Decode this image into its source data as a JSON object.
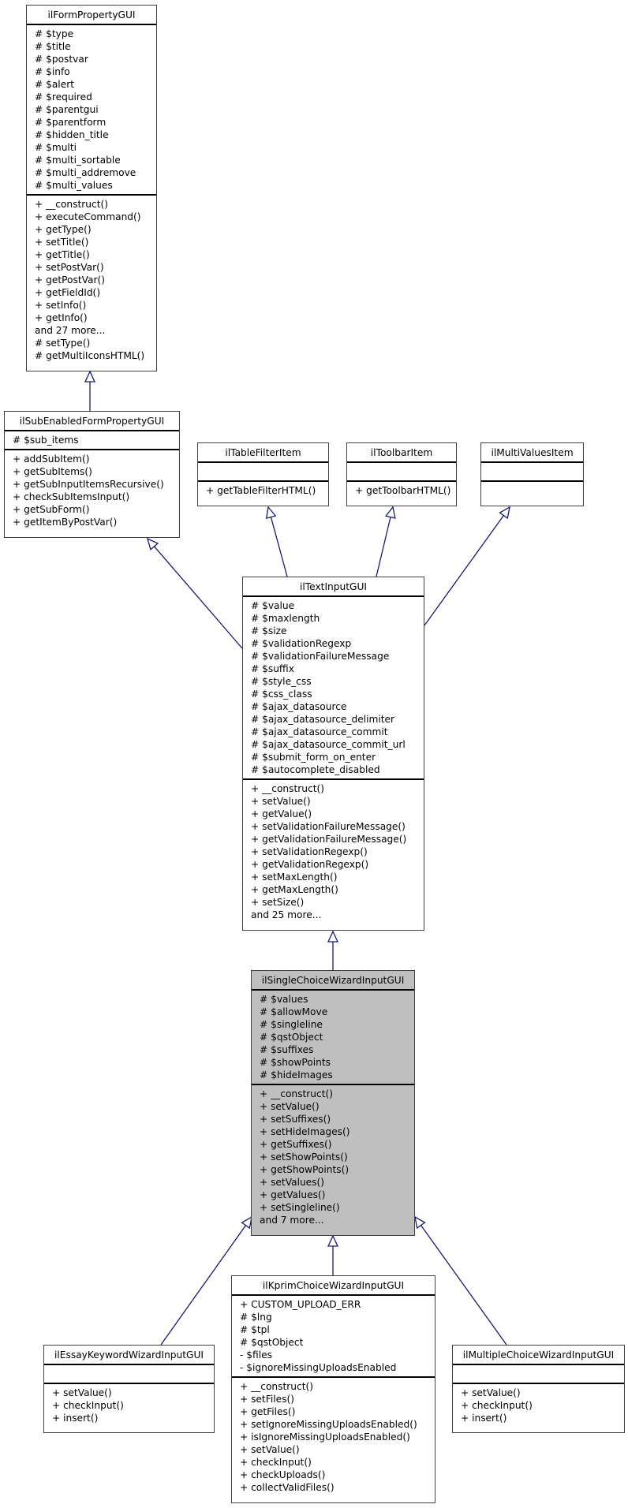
{
  "diagram": {
    "type": "uml-class-inheritance",
    "edge_color": "#191970",
    "highlight_color": "#bfbfbf"
  },
  "classes": {
    "formProperty": {
      "name": "ilFormPropertyGUI",
      "attributes": [
        "# $type",
        "# $title",
        "# $postvar",
        "# $info",
        "# $alert",
        "# $required",
        "# $parentgui",
        "# $parentform",
        "# $hidden_title",
        "# $multi",
        "# $multi_sortable",
        "# $multi_addremove",
        "# $multi_values"
      ],
      "methods": [
        "+ __construct()",
        "+ executeCommand()",
        "+ getType()",
        "+ setTitle()",
        "+ getTitle()",
        "+ setPostVar()",
        "+ getPostVar()",
        "+ getFieldId()",
        "+ setInfo()",
        "+ getInfo()",
        "and 27 more...",
        "# setType()",
        "# getMultiIconsHTML()"
      ]
    },
    "subEnabled": {
      "name": "ilSubEnabledFormPropertyGUI",
      "attributes": [
        "# $sub_items"
      ],
      "methods": [
        "+ addSubItem()",
        "+ getSubItems()",
        "+ getSubInputItemsRecursive()",
        "+ checkSubItemsInput()",
        "+ getSubForm()",
        "+ getItemByPostVar()"
      ]
    },
    "tableFilter": {
      "name": "ilTableFilterItem",
      "attributes": [],
      "methods": [
        "+ getTableFilterHTML()"
      ]
    },
    "toolbar": {
      "name": "ilToolbarItem",
      "attributes": [],
      "methods": [
        "+ getToolbarHTML()"
      ]
    },
    "multiValues": {
      "name": "ilMultiValuesItem",
      "attributes": [],
      "methods": []
    },
    "textInput": {
      "name": "ilTextInputGUI",
      "attributes": [
        "# $value",
        "# $maxlength",
        "# $size",
        "# $validationRegexp",
        "# $validationFailureMessage",
        "# $suffix",
        "# $style_css",
        "# $css_class",
        "# $ajax_datasource",
        "# $ajax_datasource_delimiter",
        "# $ajax_datasource_commit",
        "# $ajax_datasource_commit_url",
        "# $submit_form_on_enter",
        "# $autocomplete_disabled"
      ],
      "methods": [
        "+ __construct()",
        "+ setValue()",
        "+ getValue()",
        "+ setValidationFailureMessage()",
        "+ getValidationFailureMessage()",
        "+ setValidationRegexp()",
        "+ getValidationRegexp()",
        "+ setMaxLength()",
        "+ getMaxLength()",
        "+ setSize()",
        "and 25 more..."
      ]
    },
    "singleChoice": {
      "name": "ilSingleChoiceWizardInputGUI",
      "attributes": [
        "# $values",
        "# $allowMove",
        "# $singleline",
        "# $qstObject",
        "# $suffixes",
        "# $showPoints",
        "# $hideImages"
      ],
      "methods": [
        "+ __construct()",
        "+ setValue()",
        "+ setSuffixes()",
        "+ setHideImages()",
        "+ getSuffixes()",
        "+ setShowPoints()",
        "+ getShowPoints()",
        "+ setValues()",
        "+ getValues()",
        "+ setSingleline()",
        "and 7 more..."
      ]
    },
    "essayKeyword": {
      "name": "ilEssayKeywordWizardInputGUI",
      "attributes": [],
      "methods": [
        "+ setValue()",
        "+ checkInput()",
        "+ insert()"
      ]
    },
    "kprimChoice": {
      "name": "ilKprimChoiceWizardInputGUI",
      "attributes": [
        "+ CUSTOM_UPLOAD_ERR",
        "# $lng",
        "# $tpl",
        "# $qstObject",
        "- $files",
        "- $ignoreMissingUploadsEnabled"
      ],
      "methods": [
        "+ __construct()",
        "+ setFiles()",
        "+ getFiles()",
        "+ setIgnoreMissingUploadsEnabled()",
        "+ isIgnoreMissingUploadsEnabled()",
        "+ setValue()",
        "+ checkInput()",
        "+ checkUploads()",
        "+ collectValidFiles()"
      ]
    },
    "multipleChoice": {
      "name": "ilMultipleChoiceWizardInputGUI",
      "attributes": [],
      "methods": [
        "+ setValue()",
        "+ checkInput()",
        "+ insert()"
      ]
    }
  },
  "inheritance": [
    {
      "child": "ilSubEnabledFormPropertyGUI",
      "parent": "ilFormPropertyGUI"
    },
    {
      "child": "ilTextInputGUI",
      "parent": "ilSubEnabledFormPropertyGUI"
    },
    {
      "child": "ilTextInputGUI",
      "parent": "ilTableFilterItem"
    },
    {
      "child": "ilTextInputGUI",
      "parent": "ilToolbarItem"
    },
    {
      "child": "ilTextInputGUI",
      "parent": "ilMultiValuesItem"
    },
    {
      "child": "ilSingleChoiceWizardInputGUI",
      "parent": "ilTextInputGUI"
    },
    {
      "child": "ilEssayKeywordWizardInputGUI",
      "parent": "ilSingleChoiceWizardInputGUI"
    },
    {
      "child": "ilKprimChoiceWizardInputGUI",
      "parent": "ilSingleChoiceWizardInputGUI"
    },
    {
      "child": "ilMultipleChoiceWizardInputGUI",
      "parent": "ilSingleChoiceWizardInputGUI"
    }
  ]
}
